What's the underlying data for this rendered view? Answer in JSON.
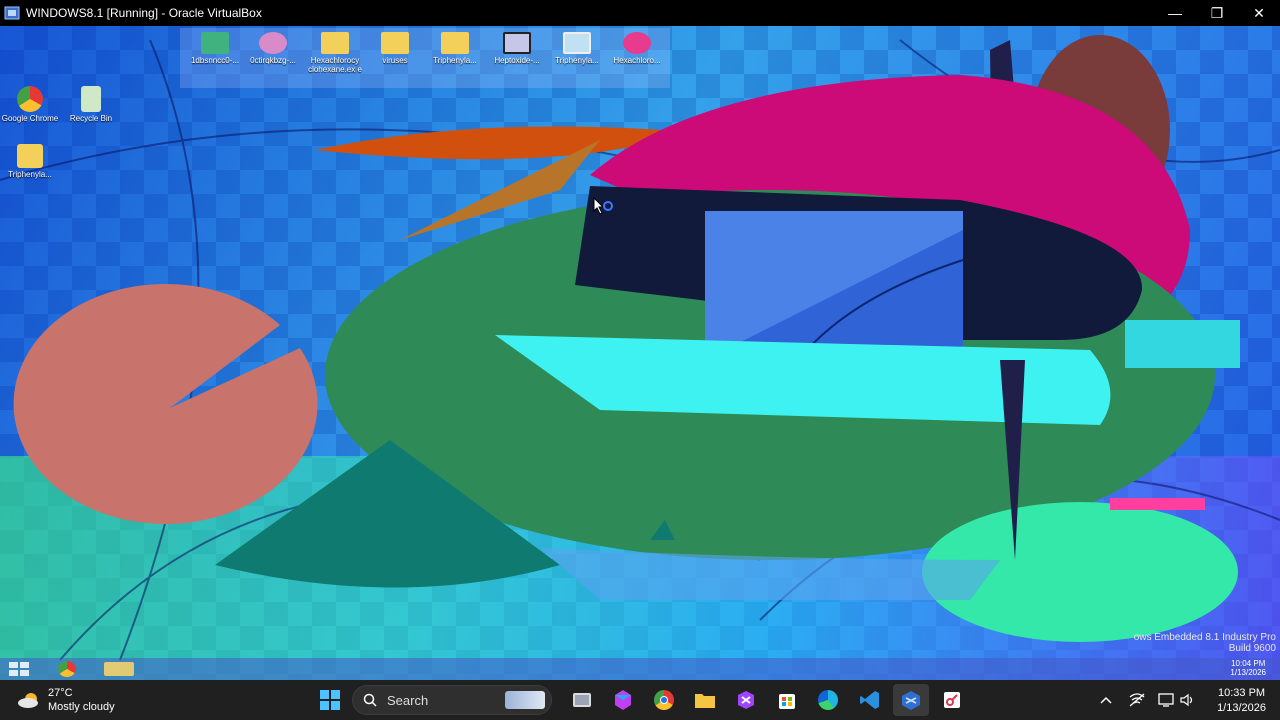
{
  "host_window": {
    "title": "WINDOWS8.1 [Running] - Oracle VirtualBox",
    "controls": {
      "minimize": "—",
      "restore": "❐",
      "close": "✕"
    }
  },
  "guest": {
    "top_icons": [
      {
        "label": "1dbsnncc0-...",
        "color": "#3fb27f"
      },
      {
        "label": "0ctirqkbzg-...",
        "color": "#d98ac9"
      },
      {
        "label": "Hexachlorocy clohexane.ex e",
        "color": "#f2d05a"
      },
      {
        "label": "viruses",
        "color": "#f2d05a"
      },
      {
        "label": "Triphenyla...",
        "color": "#f2d05a"
      },
      {
        "label": "Heptoxide-...",
        "color": "#c6c6e8"
      },
      {
        "label": "Triphenyla...",
        "color": "#bfe1f2"
      },
      {
        "label": "Hexachloro...",
        "color": "#e83b8e"
      }
    ],
    "left_icons": [
      {
        "label": "Google Chrome",
        "icon": "chrome-icon"
      },
      {
        "label": "Recycle Bin",
        "icon": "recycle-bin-icon"
      },
      {
        "label": "Triphenyla...",
        "icon": "folder-icon"
      }
    ],
    "watermark": {
      "line1": "ows Embedded 8.1 Industry Pro",
      "line2": "Build 9600"
    },
    "clock": {
      "time": "10:04 PM",
      "date": "1/13/2026"
    }
  },
  "host_taskbar": {
    "weather": {
      "temp": "27°C",
      "condition": "Mostly cloudy"
    },
    "search_label": "Search",
    "apps": [
      "start",
      "search",
      "file-explorer-cards",
      "task-view",
      "m365",
      "chrome",
      "file-explorer",
      "visual-studio",
      "microsoft-store",
      "edge",
      "vscode",
      "virtualbox",
      "snipping-tool"
    ],
    "clock": {
      "time": "10:33 PM",
      "date": "1/13/2026"
    }
  },
  "colors": {
    "magenta": "#cc0a78",
    "green": "#2e8b57",
    "salmon": "#c8736b",
    "navy": "#111a3a",
    "orange": "#d2500d",
    "cyan": "#3ef2f2",
    "mint": "#33e8a8"
  }
}
